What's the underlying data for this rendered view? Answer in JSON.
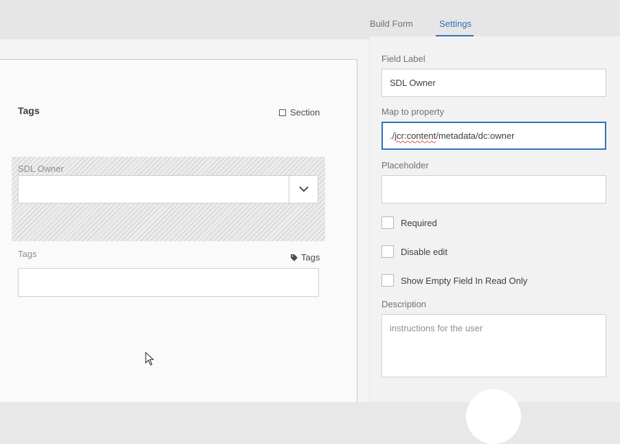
{
  "tabs": [
    {
      "label": "Build Form",
      "active": false
    },
    {
      "label": "Settings",
      "active": true
    }
  ],
  "accent_color": "#2d72b8",
  "canvas": {
    "card_title": "Tags",
    "section_label": "Section",
    "selected_field_label": "SDL Owner",
    "tags_field_label": "Tags",
    "tags_type_label": "Tags"
  },
  "settings": {
    "field_label": {
      "label": "Field Label",
      "value": "SDL Owner"
    },
    "map_to_property": {
      "label": "Map to property",
      "value_prefix": "./",
      "value_misspelled": "jcr:content",
      "value_suffix": "/metadata/dc:owner"
    },
    "placeholder": {
      "label": "Placeholder",
      "value": ""
    },
    "required": {
      "label": "Required",
      "checked": false
    },
    "disable_edit": {
      "label": "Disable edit",
      "checked": false
    },
    "show_empty": {
      "label": "Show Empty Field In Read Only",
      "checked": false
    },
    "description": {
      "label": "Description",
      "placeholder": "instructions for the user"
    }
  }
}
